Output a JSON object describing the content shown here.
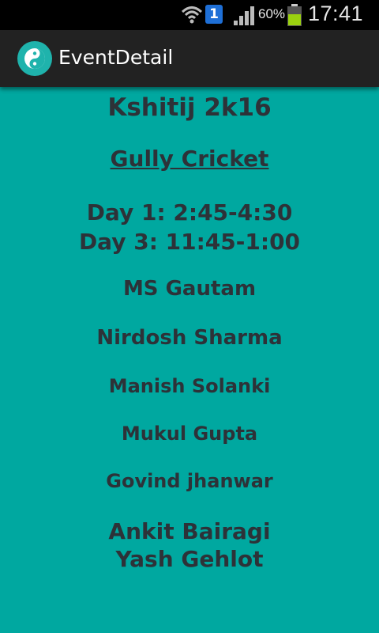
{
  "status_bar": {
    "notification_count": "1",
    "battery_percent": "60%",
    "time": "17:41",
    "icons": [
      "wifi-icon",
      "notification-icon",
      "signal-icon",
      "battery-icon"
    ]
  },
  "action_bar": {
    "title": "EventDetail",
    "icon": "app-icon"
  },
  "event": {
    "fest": "Kshitij 2k16",
    "name": "Gully Cricket",
    "schedule": [
      "Day 1: 2:45-4:30",
      "Day 3: 11:45-1:00"
    ],
    "coordinators": [
      "MS Gautam",
      "Nirdosh Sharma",
      "Manish Solanki",
      "Mukul Gupta",
      "Govind jhanwar"
    ],
    "coordinators_extra": [
      "Ankit Bairagi",
      "Yash Gehlot"
    ]
  },
  "colors": {
    "background": "#00a8a0",
    "action_bar": "#222222",
    "text": "#2d3238"
  }
}
